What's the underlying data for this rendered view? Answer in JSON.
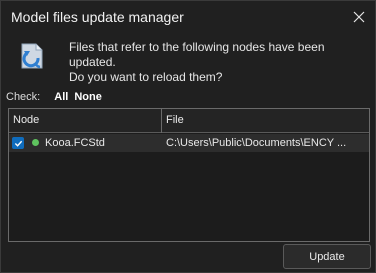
{
  "window": {
    "title": "Model files update manager"
  },
  "message": {
    "line1": "Files that refer to the following nodes have been updated.",
    "line2": "Do you want to reload them?"
  },
  "check": {
    "label": "Check:",
    "all": "All",
    "none": "None"
  },
  "table": {
    "columns": [
      "Node",
      "File"
    ],
    "rows": [
      {
        "checked": true,
        "status_color": "#5fc35f",
        "node": "Kooa.FCStd",
        "file": "C:\\Users\\Public\\Documents\\ENCY ..."
      }
    ]
  },
  "buttons": {
    "update": "Update"
  },
  "colors": {
    "accent": "#0f6cbd",
    "status_ok": "#5fc35f"
  },
  "icons": {
    "message": "refresh-document-icon",
    "close": "close-icon",
    "checkbox": "checkmark-icon"
  }
}
